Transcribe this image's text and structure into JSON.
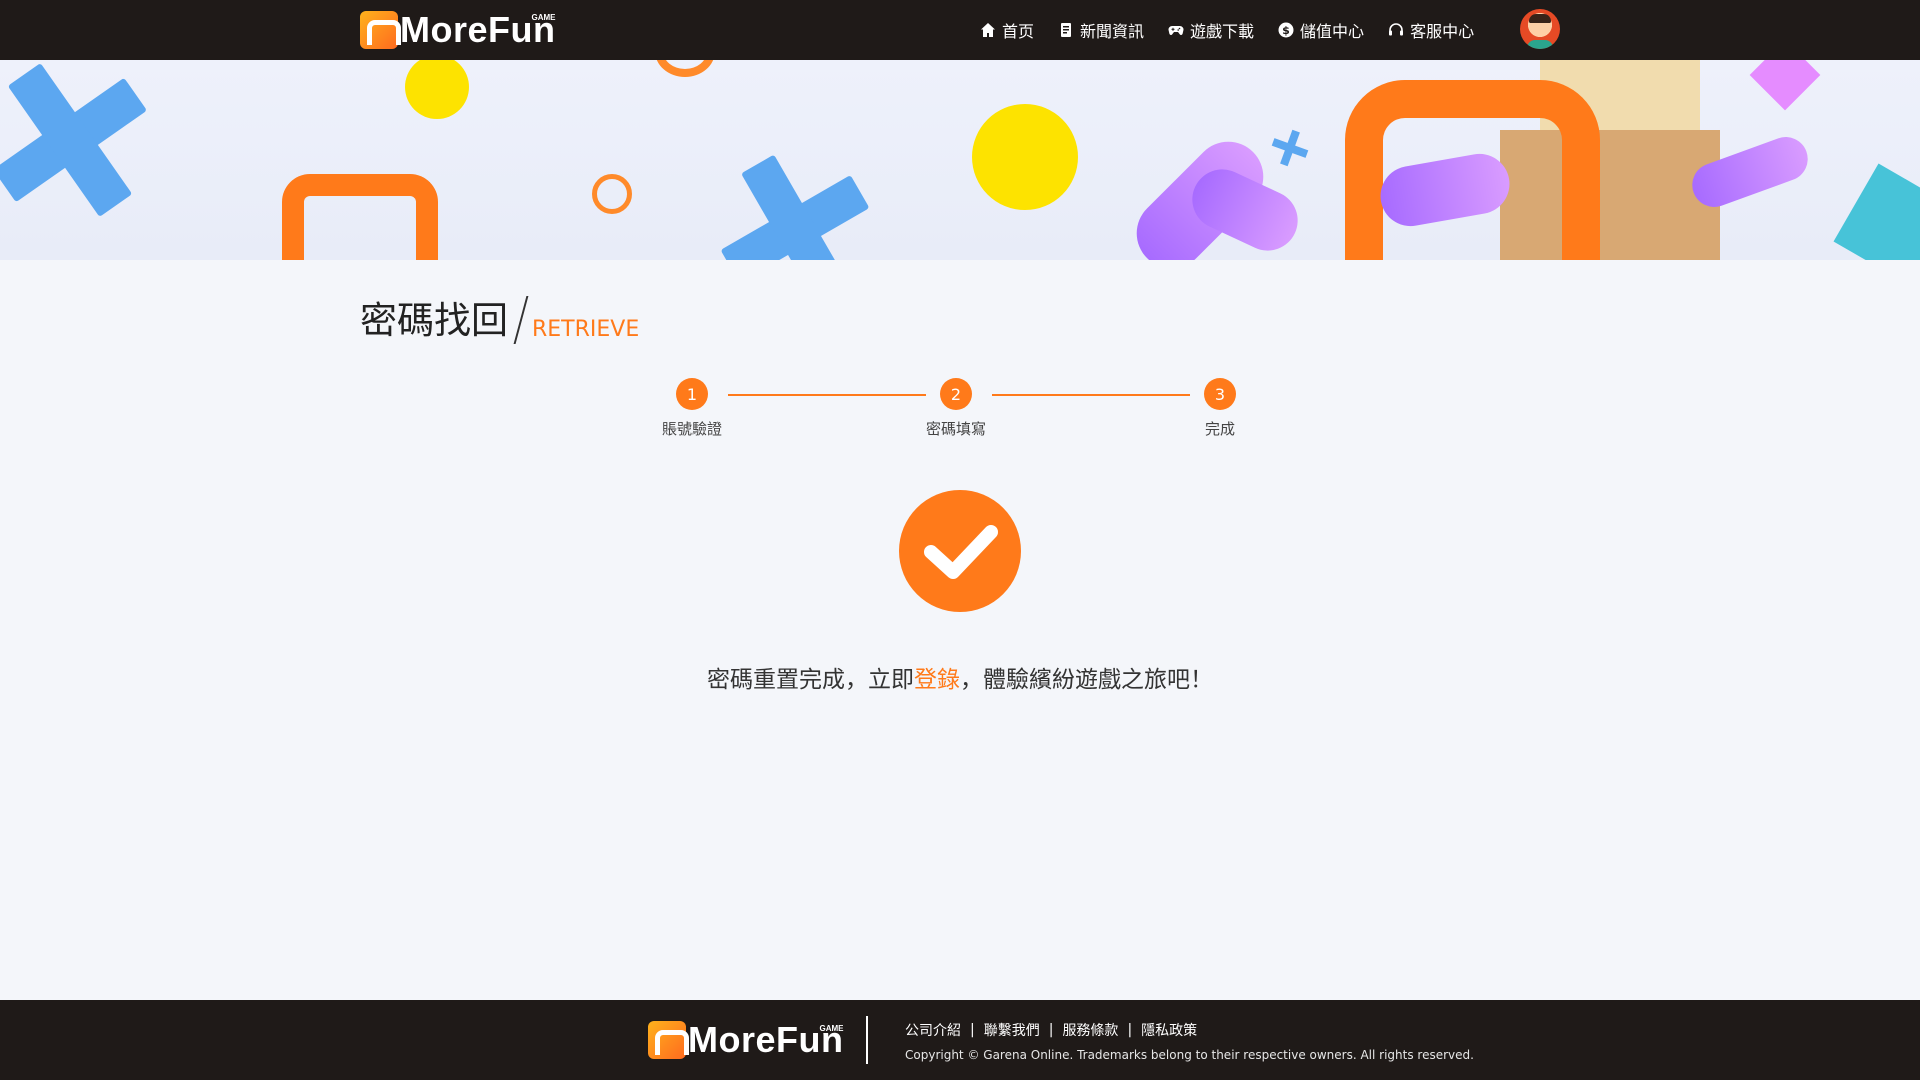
{
  "header": {
    "logo_text": "MoreFun",
    "logo_tag": "GAME",
    "nav": [
      {
        "label": "首页",
        "icon": "home-icon"
      },
      {
        "label": "新聞資訊",
        "icon": "document-icon"
      },
      {
        "label": "遊戲下載",
        "icon": "gamepad-icon"
      },
      {
        "label": "儲值中心",
        "icon": "dollar-icon"
      },
      {
        "label": "客服中心",
        "icon": "headset-icon"
      }
    ]
  },
  "page": {
    "title_zh": "密碼找回",
    "title_en": "RETRIEVE"
  },
  "steps": [
    {
      "number": "1",
      "label": "賬號驗證"
    },
    {
      "number": "2",
      "label": "密碼填寫"
    },
    {
      "number": "3",
      "label": "完成"
    }
  ],
  "result": {
    "before": "密碼重置完成，立即",
    "link": "登錄",
    "after": "，體驗繽紛遊戲之旅吧！"
  },
  "footer": {
    "links": [
      "公司介紹",
      "聯繫我們",
      "服務條款",
      "隱私政策"
    ],
    "separator": "|",
    "copyright": "Copyright © Garena Online. Trademarks belong to their respective owners. All rights reserved."
  },
  "colors": {
    "accent": "#ff7a1a",
    "dark": "#1f1a18",
    "background": "#f4f6fa"
  }
}
